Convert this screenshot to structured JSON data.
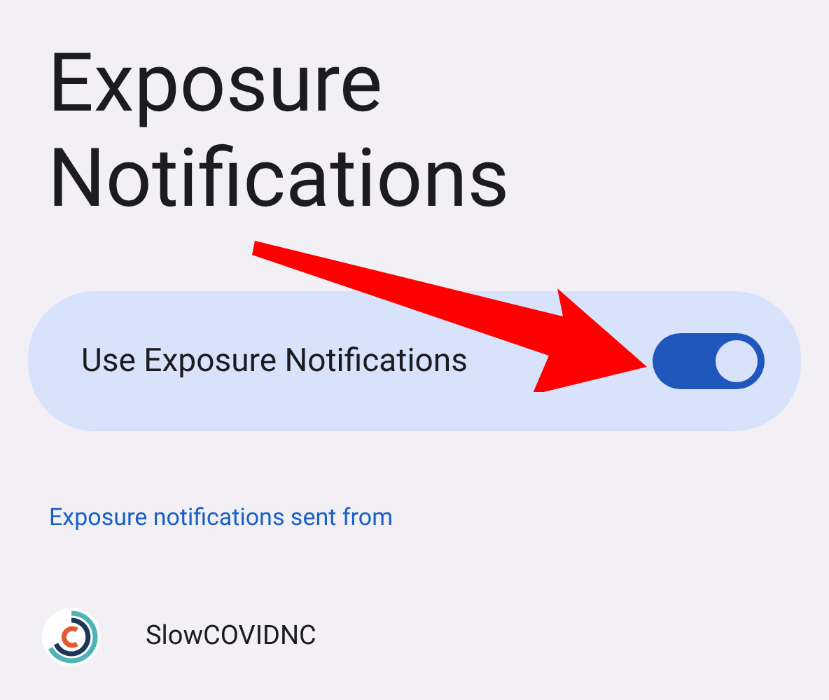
{
  "title": "Exposure Notifications",
  "setting": {
    "label": "Use Exposure Notifications",
    "on": true
  },
  "section_link": "Exposure notifications sent from",
  "apps": [
    {
      "name": "SlowCOVIDNC"
    }
  ]
}
